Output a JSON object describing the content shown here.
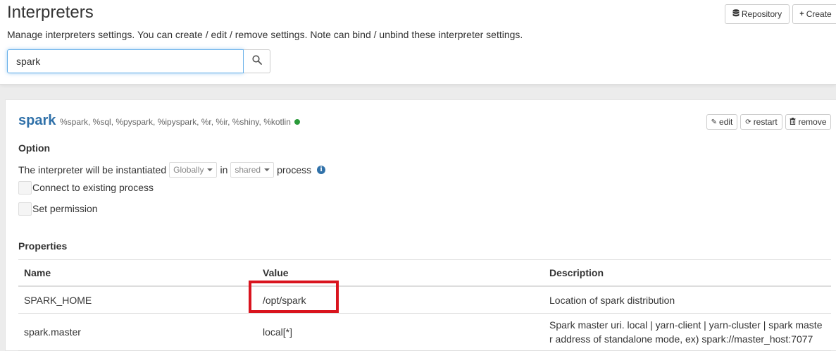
{
  "header": {
    "title": "Interpreters",
    "description": "Manage interpreters settings. You can create / edit / remove settings. Note can bind / unbind these interpreter settings.",
    "repository_label": "Repository",
    "create_label": "Create",
    "search": {
      "value": "spark",
      "placeholder": ""
    }
  },
  "interpreter": {
    "name": "spark",
    "bindings": "%spark, %sql, %pyspark, %ipyspark, %r, %ir, %shiny, %kotlin",
    "status_color": "#2a9a3a",
    "actions": {
      "edit": "edit",
      "restart": "restart",
      "remove": "remove"
    },
    "option": {
      "title": "Option",
      "instantiated_prefix": "The interpreter will be instantiated",
      "scope": "Globally",
      "in_label": "in",
      "mode": "shared",
      "process_label": "process",
      "connect_existing_label": "Connect to existing process",
      "set_permission_label": "Set permission"
    },
    "properties": {
      "title": "Properties",
      "columns": [
        "Name",
        "Value",
        "Description"
      ],
      "rows": [
        {
          "name": "SPARK_HOME",
          "value": "/opt/spark",
          "description": "Location of spark distribution"
        },
        {
          "name": "spark.master",
          "value": "local[*]",
          "description": "Spark master uri. local | yarn-client | yarn-cluster | spark master address of standalone mode, ex) spark://master_host:7077"
        }
      ]
    }
  },
  "colors": {
    "accent": "#3071a9",
    "highlight": "#d9141e"
  }
}
